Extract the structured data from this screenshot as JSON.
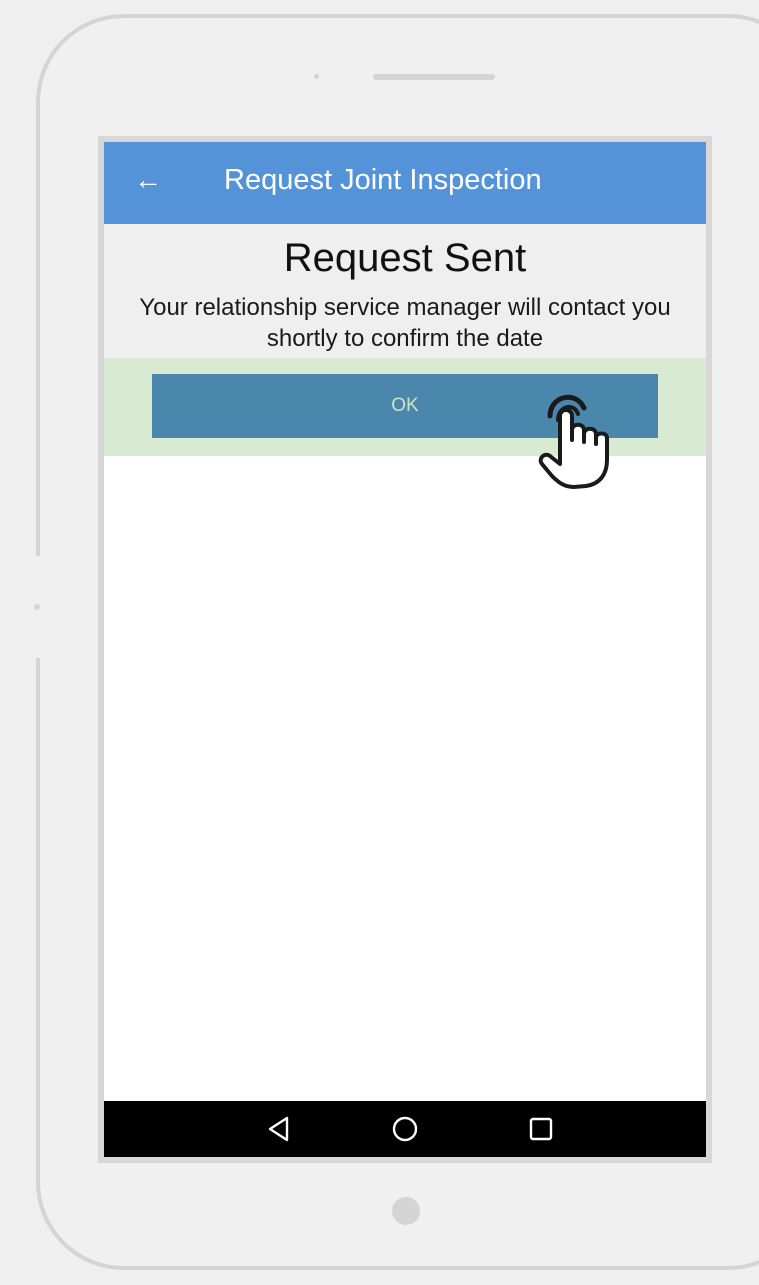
{
  "app_bar": {
    "back_icon": "arrow-left-icon",
    "title": "Request Joint Inspection"
  },
  "message": {
    "heading": "Request Sent",
    "body": "Your relationship service manager will contact you shortly to confirm the date"
  },
  "ok_button": {
    "label": "OK"
  },
  "nav_bar": {
    "icons": [
      "back-triangle-icon",
      "home-circle-icon",
      "recents-square-icon"
    ]
  },
  "colors": {
    "app_bar": "#5593d9",
    "message_background": "#efefef",
    "ok_area_background": "#d8ead1",
    "ok_button": "#4b86ad",
    "nav_bar": "#000000",
    "device_frame": "#d4d4d4"
  },
  "overlay": {
    "icon": "tap-hand-pointer-icon"
  }
}
